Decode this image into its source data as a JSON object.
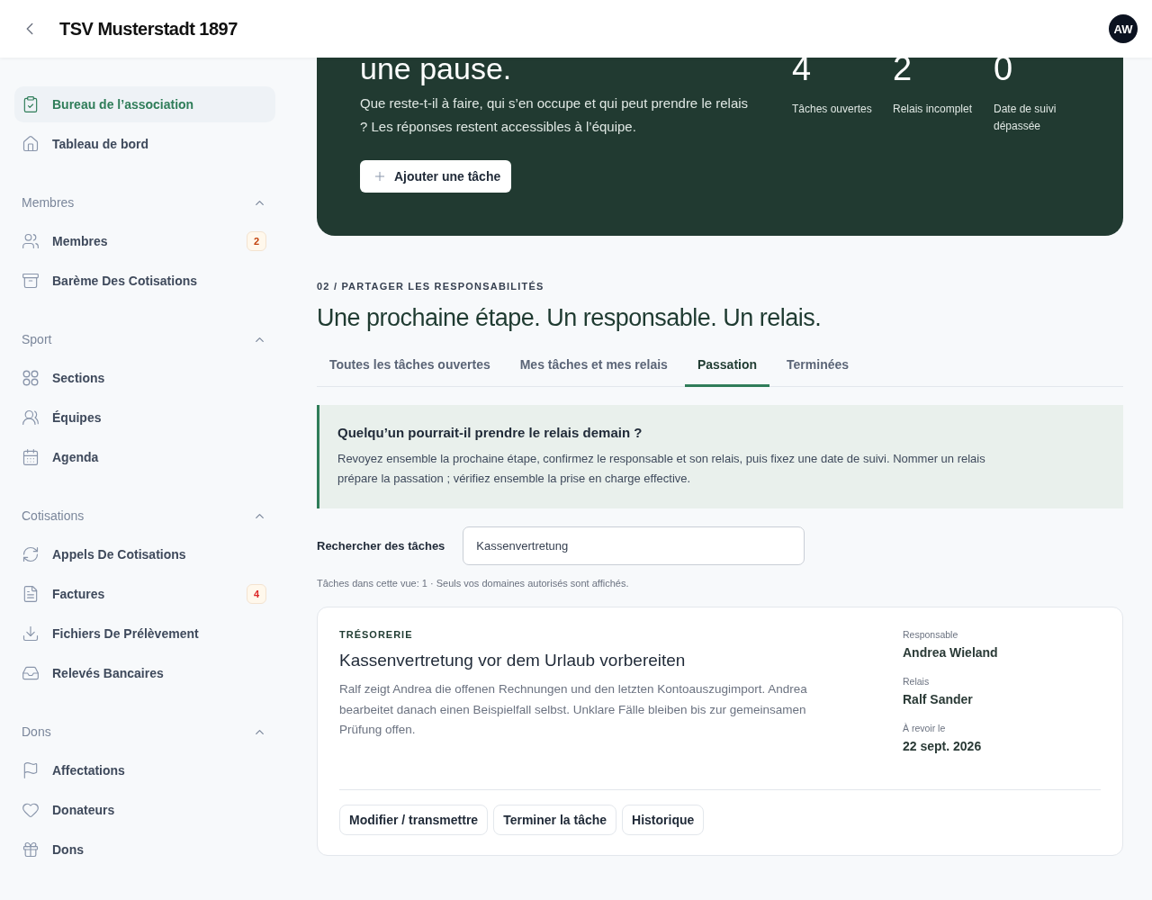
{
  "header": {
    "title": "TSV Musterstadt 1897",
    "avatar": "AW"
  },
  "sidebar": {
    "top_items": [
      {
        "label": "Bureau de l’association",
        "selected": true
      },
      {
        "label": "Tableau de bord",
        "selected": false
      }
    ],
    "groups": [
      {
        "title": "Membres",
        "expanded": true,
        "items": [
          {
            "label": "Membres",
            "selected": false,
            "badge": {
              "text": "2",
              "color": "#c2410c"
            }
          },
          {
            "label": "Barème Des Cotisations",
            "selected": false
          }
        ]
      },
      {
        "title": "Sport",
        "expanded": true,
        "items": [
          {
            "label": "Sections",
            "selected": false
          },
          {
            "label": "Équipes",
            "selected": false
          },
          {
            "label": "Agenda",
            "selected": false
          }
        ]
      },
      {
        "title": "Cotisations",
        "expanded": true,
        "items": [
          {
            "label": "Appels De Cotisations",
            "selected": false
          },
          {
            "label": "Factures",
            "selected": false,
            "badge": {
              "text": "4",
              "color": "#dc2626"
            }
          },
          {
            "label": "Fichiers De Prélèvement",
            "selected": false
          },
          {
            "label": "Relevés Bancaires",
            "selected": false
          }
        ]
      },
      {
        "title": "Dons",
        "expanded": true,
        "items": [
          {
            "label": "Affectations",
            "selected": false
          },
          {
            "label": "Donateurs",
            "selected": false
          },
          {
            "label": "Dons",
            "selected": false
          }
        ]
      }
    ]
  },
  "hero": {
    "heading": "une pause.",
    "text": "Que reste-t-il à faire, qui s’en occupe et qui peut prendre le relais ? Les réponses restent accessibles à l’équipe.",
    "button": "Ajouter une tâche",
    "stats": [
      {
        "value": "4",
        "label": "Tâches ouvertes"
      },
      {
        "value": "2",
        "label": "Relais incomplet"
      },
      {
        "value": "0",
        "label": "Date de suivi dépassée"
      }
    ]
  },
  "section": {
    "eyebrow": "02 / PARTAGER LES RESPONSABILITÉS",
    "heading": "Une prochaine étape. Un responsable. Un relais.",
    "tabs": [
      {
        "label": "Toutes les tâches ouvertes",
        "selected": false
      },
      {
        "label": "Mes tâches et mes relais",
        "selected": false
      },
      {
        "label": "Passation",
        "selected": true
      },
      {
        "label": "Terminées",
        "selected": false
      }
    ],
    "callout": {
      "title": "Quelqu’un pourrait-il prendre le relais demain ?",
      "text": "Revoyez ensemble la prochaine étape, confirmez le responsable et son relais, puis fixez une date de suivi. Nommer un relais prépare la passation ; vérifiez ensemble la prise en charge effective."
    },
    "search": {
      "label": "Rechercher des tâches",
      "value": "Kassenvertretung"
    },
    "note": "Tâches dans cette vue: 1 · Seuls vos domaines autorisés sont affichés.",
    "tasks": [
      {
        "category": "TRÉSORERIE",
        "title": "Kassenvertretung vor dem Urlaub vorbereiten",
        "description": "Ralf zeigt Andrea die offenen Rechnungen und den letzten Kontoauszugimport. Andrea bearbeitet danach einen Beispielfall selbst. Unklare Fälle bleiben bis zur gemeinsamen Prüfung offen.",
        "meta": [
          {
            "label": "Responsable",
            "value": "Andrea Wieland"
          },
          {
            "label": "Relais",
            "value": "Ralf Sander"
          },
          {
            "label": "À revoir le",
            "value": "22 sept. 2026"
          }
        ],
        "actions": [
          "Modifier / transmettre",
          "Terminer la tâche",
          "Historique"
        ]
      }
    ]
  }
}
